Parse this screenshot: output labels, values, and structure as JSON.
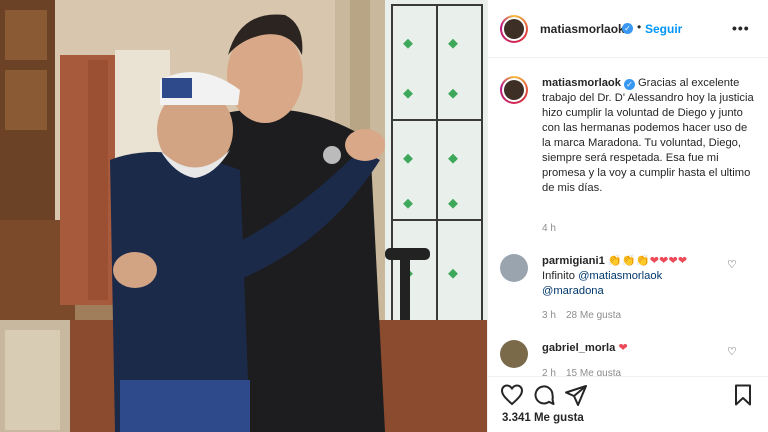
{
  "header": {
    "username": "matiasmorlaok",
    "separator": "•",
    "follow_label": "Seguir",
    "more_label": "•••"
  },
  "caption": {
    "username": "matiasmorlaok",
    "text": "Gracias al excelente trabajo del Dr. D' Alessandro hoy la justicia hizo cumplir la voluntad de Diego y junto con las hermanas podemos hacer uso de la marca Maradona. Tu voluntad, Diego, siempre será respetada. Esa fue mi promesa y la voy a cumplir hasta el ultimo de mis días.",
    "time": "4 h"
  },
  "comments": [
    {
      "username": "parmigiani1",
      "emojis": "👏👏👏❤❤❤❤",
      "text_prefix": "Infinito ",
      "mention1": "@matiasmorlaok",
      "mention2": "@maradona",
      "time": "3 h",
      "likes": "28 Me gusta"
    },
    {
      "username": "gabriel_morla",
      "emojis": "❤",
      "time": "2 h",
      "likes": "15 Me gusta"
    }
  ],
  "likes_count": "3.341 Me gusta",
  "colors": {
    "accent": "#0095f6",
    "verified": "#3897f0",
    "muted": "#8e8e8e",
    "text": "#262626"
  },
  "icons": {
    "like": "heart-icon",
    "comment": "comment-icon",
    "share": "paper-plane-icon",
    "save": "bookmark-icon",
    "more": "more-options-icon",
    "verified": "verified-badge-icon"
  }
}
